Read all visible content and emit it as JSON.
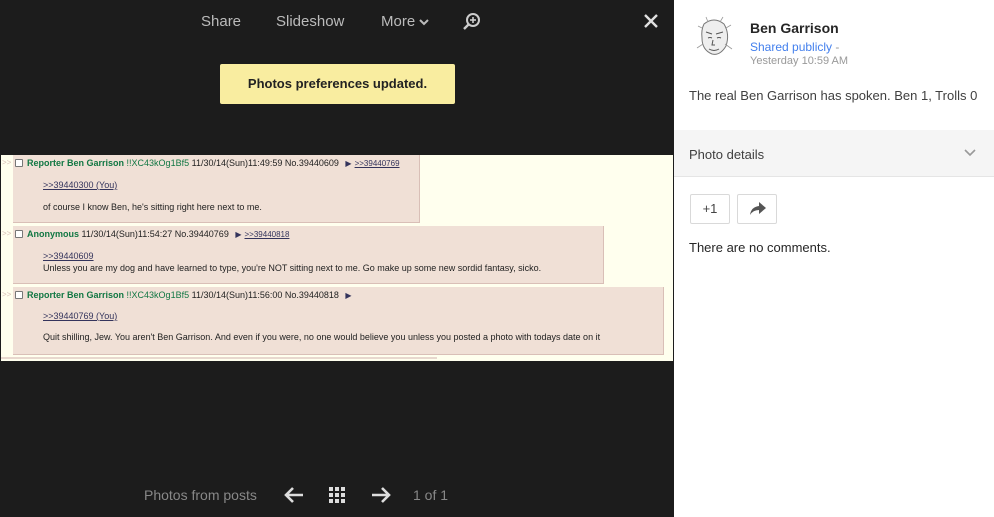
{
  "viewer": {
    "toolbar": {
      "share_label": "Share",
      "slideshow_label": "Slideshow",
      "more_label": "More"
    },
    "toast": "Photos preferences updated.",
    "bottom": {
      "photos_from_label": "Photos from posts",
      "counter": "1 of 1"
    }
  },
  "photo": {
    "posts": [
      {
        "name": "Reporter Ben Garrison",
        "trip": "!!XC43kOg1Bf5",
        "meta": "11/30/14(Sun)11:49:59 No.39440609",
        "reply_link": ">>39440769",
        "quote": ">>39440300 (You)",
        "text": "of course I know Ben, he's sitting right here next to me."
      },
      {
        "name": "Anonymous",
        "trip": "",
        "meta": "11/30/14(Sun)11:54:27 No.39440769",
        "reply_link": ">>39440818",
        "quote": ">>39440609",
        "text": "Unless you are my dog and have learned to type, you're NOT sitting next to me. Go make up some new sordid fantasy, sicko."
      },
      {
        "name": "Reporter Ben Garrison",
        "trip": "!!XC43kOg1Bf5",
        "meta": "11/30/14(Sun)11:56:00 No.39440818",
        "reply_link": "",
        "quote": ">>39440769 (You)",
        "text": "Quit shilling, Jew. You aren't Ben Garrison. And even if you were, no one would believe you unless you posted a photo with todays date on it"
      }
    ]
  },
  "side": {
    "author": "Ben Garrison",
    "shared": "Shared publicly",
    "shared_dash": "-",
    "time": "Yesterday 10:59 AM",
    "caption": "The real Ben Garrison has spoken. Ben 1, Trolls 0",
    "details_label": "Photo details",
    "plus_one_label": "+1",
    "no_comments": "There are no comments."
  },
  "icons": {
    "more": "chevron-down-icon",
    "zoom": "zoom-in-icon",
    "close": "close-icon",
    "prev": "arrow-left-icon",
    "grid": "grid-icon",
    "next": "arrow-right-icon",
    "details": "chevron-down-icon",
    "share": "share-arrow-icon"
  },
  "colors": {
    "viewer_bg": "#1c1c1c",
    "toast_bg": "#f9eda0",
    "link_blue": "#427fed",
    "post_bg": "#f0e0d6",
    "post_name": "#117743"
  }
}
